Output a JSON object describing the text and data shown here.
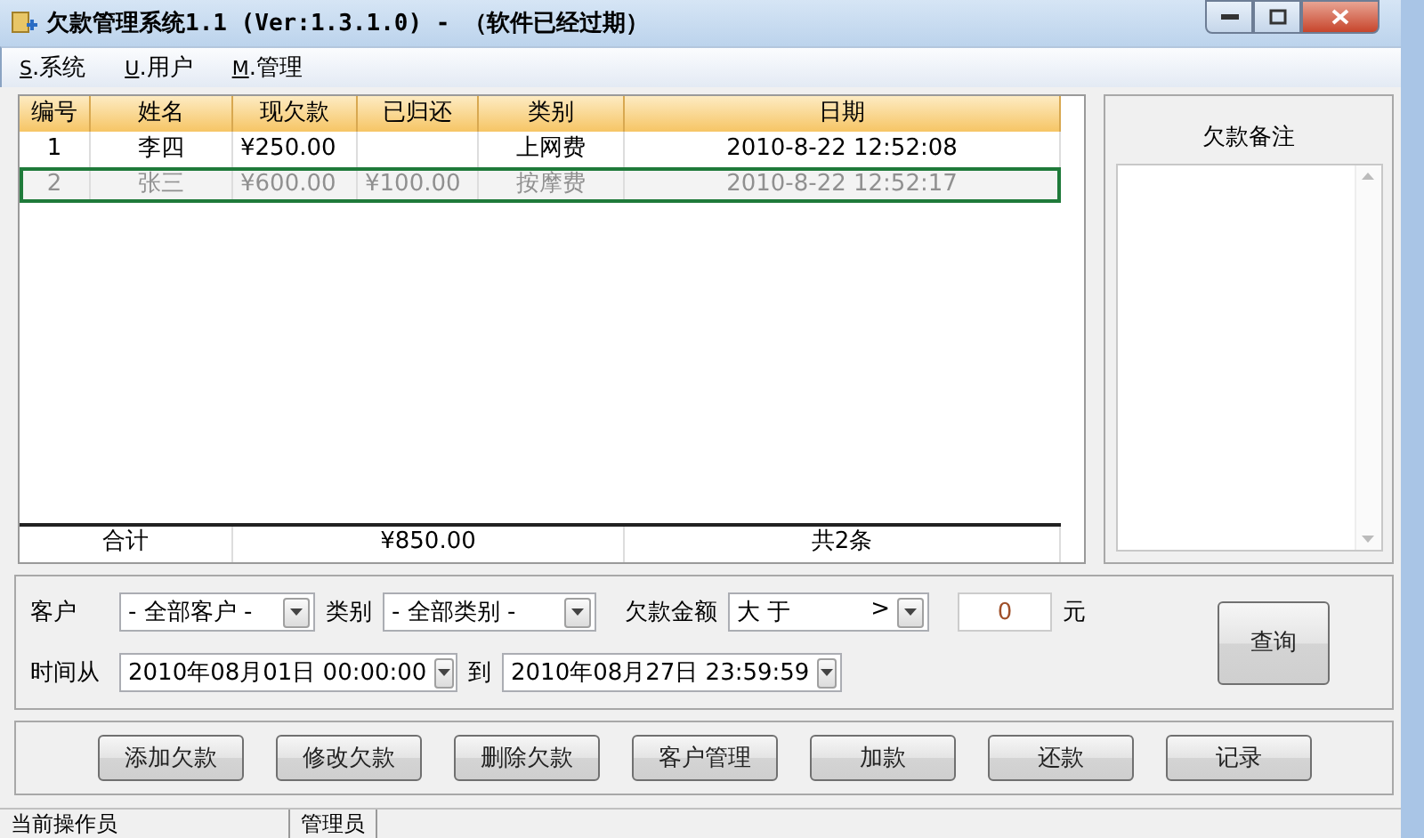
{
  "window": {
    "title": "欠款管理系统1.1 (Ver:1.3.1.0) - （软件已经过期）"
  },
  "menu": [
    {
      "mnemonic": "S",
      "label": ".系统"
    },
    {
      "mnemonic": "U",
      "label": ".用户"
    },
    {
      "mnemonic": "M",
      "label": ".管理"
    }
  ],
  "table": {
    "columns": [
      "编号",
      "姓名",
      "现欠款",
      "已归还",
      "类别",
      "日期"
    ],
    "rows": [
      {
        "cells": [
          "1",
          "李四",
          "¥250.00",
          "",
          "上网费",
          "2010-8-22 12:52:08"
        ],
        "selected": false
      },
      {
        "cells": [
          "2",
          "张三",
          "¥600.00",
          "¥100.00",
          "按摩费",
          "2010-8-22 12:52:17"
        ],
        "selected": true
      }
    ],
    "footer": [
      "合计",
      "¥850.00",
      "共2条"
    ]
  },
  "notes": {
    "title": "欠款备注"
  },
  "filter": {
    "customer_label": "客户",
    "customer_value": "- 全部客户 -",
    "category_label": "类别",
    "category_value": "- 全部类别 -",
    "amount_label": "欠款金额",
    "amount_op": "大 于",
    "amount_symbol": ">",
    "amount_value": "0",
    "amount_unit": "元",
    "from_label": "时间从",
    "from_value": "2010年08月01日 00:00:00",
    "to_label": "到",
    "to_value": "2010年08月27日 23:59:59",
    "query_button": "查询"
  },
  "actions": [
    "添加欠款",
    "修改欠款",
    "删除欠款",
    "客户管理",
    "加款",
    "还款",
    "记录"
  ],
  "status_bar": [
    "当前操作员",
    "管理员"
  ]
}
